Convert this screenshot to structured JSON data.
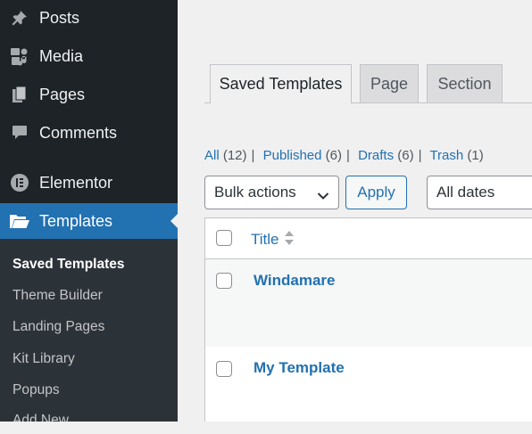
{
  "sidebar": {
    "items": [
      {
        "label": "Posts",
        "icon": "pin-icon"
      },
      {
        "label": "Media",
        "icon": "media-icon"
      },
      {
        "label": "Pages",
        "icon": "pages-icon"
      },
      {
        "label": "Comments",
        "icon": "comment-icon"
      },
      {
        "label": "Elementor",
        "icon": "elementor-icon"
      },
      {
        "label": "Templates",
        "icon": "folder-icon",
        "active": true
      }
    ],
    "submenu": [
      {
        "label": "Saved Templates",
        "current": true
      },
      {
        "label": "Theme Builder"
      },
      {
        "label": "Landing Pages"
      },
      {
        "label": "Kit Library"
      },
      {
        "label": "Popups"
      },
      {
        "label": "Add New"
      }
    ]
  },
  "tabs": [
    {
      "label": "Saved Templates",
      "active": true
    },
    {
      "label": "Page"
    },
    {
      "label": "Section"
    }
  ],
  "filters": {
    "all": {
      "label": "All",
      "count": "(12)"
    },
    "published": {
      "label": "Published",
      "count": "(6)"
    },
    "drafts": {
      "label": "Drafts",
      "count": "(6)"
    },
    "trash": {
      "label": "Trash",
      "count": "(1)"
    },
    "separator": "|"
  },
  "bulk_actions": {
    "selected": "Bulk actions",
    "apply_label": "Apply"
  },
  "date_filter": {
    "selected": "All dates"
  },
  "table": {
    "columns": [
      "Title"
    ],
    "rows": [
      {
        "title": "Windamare"
      },
      {
        "title": "My Template"
      }
    ]
  },
  "colors": {
    "sidebar_bg": "#1d2327",
    "submenu_bg": "#2c3338",
    "accent": "#2271b1",
    "page_bg": "#f0f0f1"
  }
}
